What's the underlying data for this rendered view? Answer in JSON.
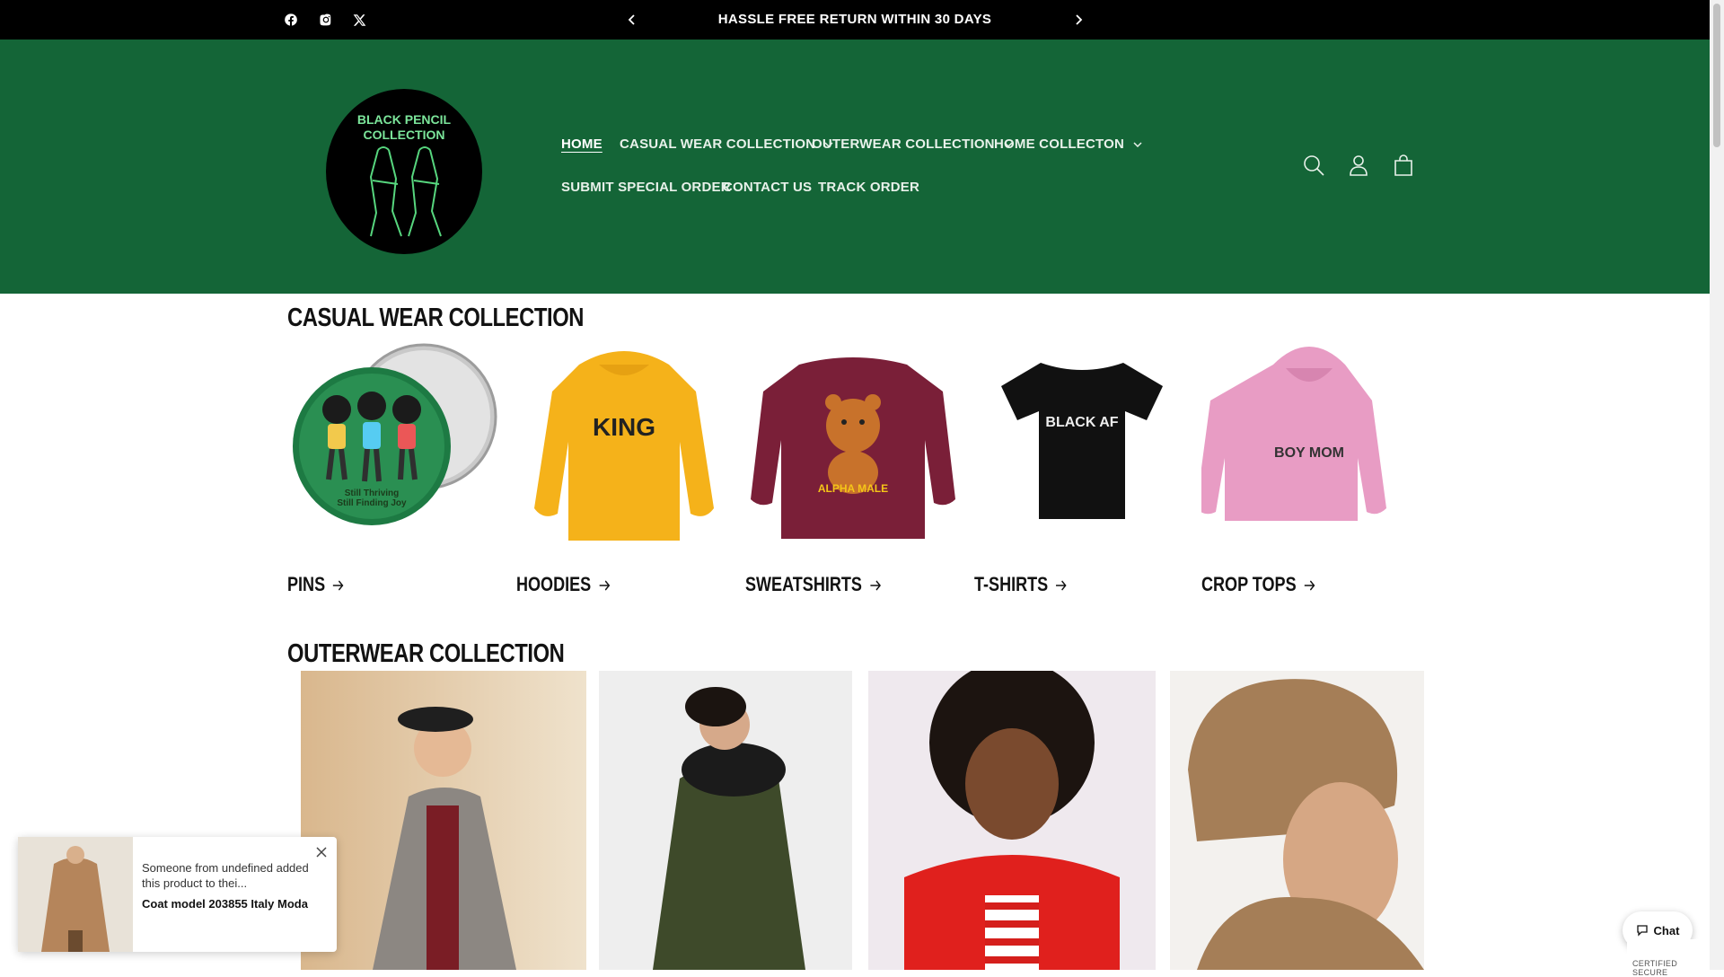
{
  "announcement": {
    "text": "HASSLE FREE RETURN WITHIN 30 DAYS",
    "social_icons": [
      "facebook-icon",
      "instagram-icon",
      "x-twitter-icon"
    ]
  },
  "logo": {
    "text_line1": "BLACK PENCIL",
    "text_line2": "COLLECTION"
  },
  "nav": {
    "home": "HOME",
    "casual": "CASUAL WEAR COLLECTION",
    "outerwear": "OUTERWEAR COLLECTION",
    "home_collection": "HOME COLLECTON",
    "special_order": "SUBMIT SPECIAL ORDER",
    "contact": "CONTACT US",
    "track": "TRACK ORDER"
  },
  "header_icons": [
    "search-icon",
    "account-icon",
    "cart-icon"
  ],
  "casual_section": {
    "title": "CASUAL WEAR COLLECTION",
    "items": [
      {
        "label": "PINS",
        "image_text": "Still Thriving Still Finding Joy"
      },
      {
        "label": "HOODIES",
        "image_text": "KING"
      },
      {
        "label": "SWEATSHIRTS",
        "image_text": "ALPHA MALE"
      },
      {
        "label": "T-SHIRTS",
        "image_text": "BLACK AF"
      },
      {
        "label": "CROP TOPS",
        "image_text": "BOY MOM"
      }
    ]
  },
  "outerwear_section": {
    "title": "OUTERWEAR COLLECTION"
  },
  "popup": {
    "message": "Someone from undefined added this product to thei...",
    "product": "Coat model 203855 Italy Moda"
  },
  "chat": {
    "label": "Chat"
  },
  "badge": {
    "text": "CERTIFIED SECURE"
  },
  "colors": {
    "header_bg": "#146537",
    "announcement_bg": "#000000"
  }
}
